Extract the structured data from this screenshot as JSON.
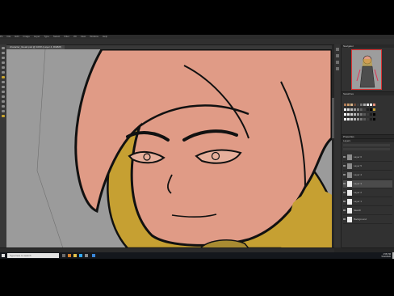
{
  "menu": {
    "items": [
      "Ps",
      "File",
      "Edit",
      "Image",
      "Layer",
      "Type",
      "Select",
      "Filter",
      "3D",
      "View",
      "Window",
      "Help"
    ]
  },
  "document_tab": {
    "label": "character_lineart.psd @ 100% (Layer 4, RGB/8)"
  },
  "panels": {
    "navigator": {
      "title": "Navigator"
    },
    "swatches": {
      "title": "Swatches",
      "rows": [
        [
          "#b07a55",
          "#c89a6a",
          "#d9b58a",
          "#6b4a3a",
          "#3c3c3c",
          "#777777",
          "#aaaaaa",
          "#e6e6e6",
          "#ffffff",
          "#e38f7a"
        ],
        [
          "#f2f2f2",
          "#dcdcdc",
          "#bfbfbf",
          "#9f9f9f",
          "#808080",
          "#606060",
          "#404040",
          "#202020",
          "#000000",
          "#c8a230"
        ],
        [
          "#ffffff",
          "#ebebeb",
          "#d2d2d2",
          "#b4b4b4",
          "#969696",
          "#787878",
          "#5a5a5a",
          "#3c3c3c",
          "#1e1e1e",
          "#000000"
        ],
        [
          "#ffffff",
          "#ebebeb",
          "#d2d2d2",
          "#b4b4b4",
          "#969696",
          "#787878",
          "#5a5a5a",
          "#3c3c3c",
          "#1e1e1e",
          "#000000"
        ]
      ]
    },
    "properties": {
      "title": "Properties"
    },
    "layers": {
      "title": "Layers",
      "items": [
        {
          "name": "Layer 6",
          "selected": false
        },
        {
          "name": "Layer 5",
          "selected": false
        },
        {
          "name": "Layer 4",
          "selected": false
        },
        {
          "name": "Layer 3",
          "selected": true
        },
        {
          "name": "Layer 2",
          "selected": false
        },
        {
          "name": "Layer 1",
          "selected": false
        },
        {
          "name": "Sketch",
          "selected": false
        },
        {
          "name": "Background",
          "selected": false
        }
      ]
    }
  },
  "taskbar": {
    "search_placeholder": "Type here to search",
    "time": "4:58 PM",
    "date": "5/12/2020"
  },
  "colors": {
    "skin": "#e09b86",
    "hair": "#c6a032",
    "line": "#111111",
    "canvas_bg": "#9a9a9a"
  }
}
